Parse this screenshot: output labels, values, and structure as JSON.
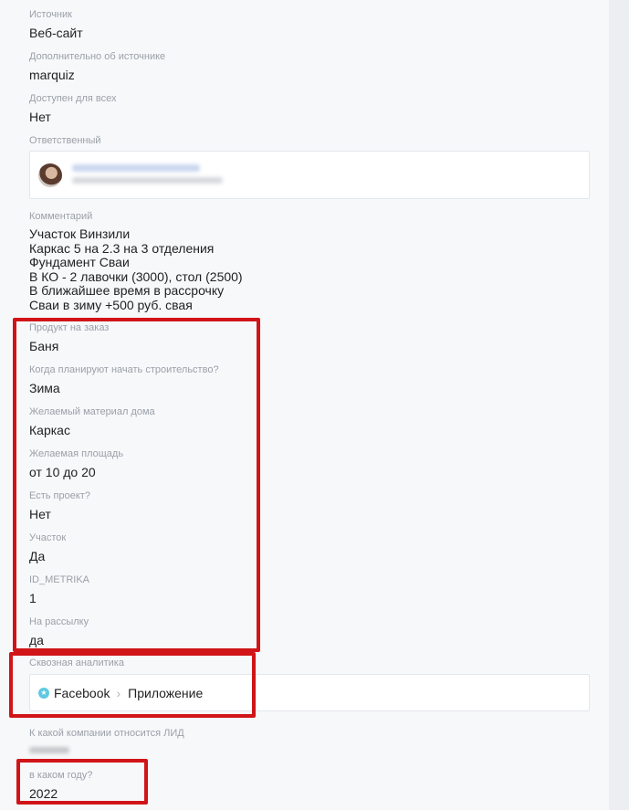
{
  "fields": {
    "source": {
      "label": "Источник",
      "value": "Веб-сайт"
    },
    "source_extra": {
      "label": "Дополнительно об источнике",
      "value": "marquiz"
    },
    "available_all": {
      "label": "Доступен для всех",
      "value": "Нет"
    },
    "responsible": {
      "label": "Ответственный"
    },
    "comment": {
      "label": "Комментарий",
      "lines": [
        "Участок Винзили",
        "Каркас 5 на 2.3 на 3 отделения",
        "Фундамент Сваи",
        "В КО - 2 лавочки (3000), стол (2500)",
        "В ближайшее время в рассрочку",
        "Сваи в зиму +500 руб. свая"
      ]
    },
    "product": {
      "label": "Продукт на заказ",
      "value": "Баня"
    },
    "start_build": {
      "label": "Когда планируют начать строительство?",
      "value": "Зима"
    },
    "material": {
      "label": "Желаемый материал дома",
      "value": "Каркас"
    },
    "area": {
      "label": "Желаемая площадь",
      "value": "от 10 до 20"
    },
    "project": {
      "label": "Есть проект?",
      "value": "Нет"
    },
    "plot": {
      "label": "Участок",
      "value": "Да"
    },
    "metrika": {
      "label": "ID_METRIKA",
      "value": "1"
    },
    "mailing": {
      "label": "На рассылку",
      "value": "да"
    },
    "analytics": {
      "label": "Сквозная аналитика",
      "source": "Facebook",
      "channel": "Приложение"
    },
    "company": {
      "label": "К какой компании относится ЛИД"
    },
    "year": {
      "label": "в каком году?",
      "value": "2022"
    }
  },
  "colors": {
    "highlight": "#d01417",
    "analytics_dot": "#5ec8e0"
  },
  "icons": {
    "analytics_dot": "star-icon",
    "separator": "chevron-right-icon"
  }
}
